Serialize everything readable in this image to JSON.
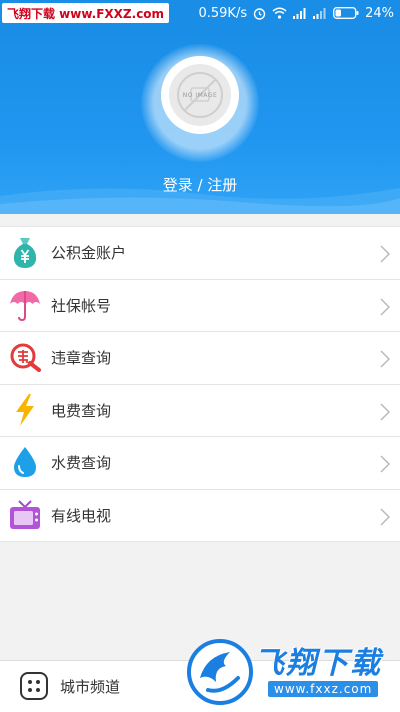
{
  "status_bar": {
    "watermark": "飞翔下载 www.FXXZ.com",
    "network_speed": "0.59K/s",
    "battery": "24%"
  },
  "profile": {
    "avatar_placeholder": "NO IMAGE",
    "login_text": "登录 / 注册"
  },
  "menu": {
    "items": [
      {
        "label": "公积金账户",
        "icon": "money-bag-icon"
      },
      {
        "label": "社保帐号",
        "icon": "umbrella-icon"
      },
      {
        "label": "违章查询",
        "icon": "violation-icon"
      },
      {
        "label": "电费查询",
        "icon": "lightning-icon"
      },
      {
        "label": "水费查询",
        "icon": "water-drop-icon"
      },
      {
        "label": "有线电视",
        "icon": "tv-icon"
      }
    ]
  },
  "bottom_bar": {
    "city_channel": "城市频道"
  },
  "watermark_bottom": {
    "brand": "飞翔下载",
    "url": "www.fxxz.com"
  },
  "colors": {
    "header_blue": "#1a8ee6",
    "watermark_red": "#d0021b"
  }
}
